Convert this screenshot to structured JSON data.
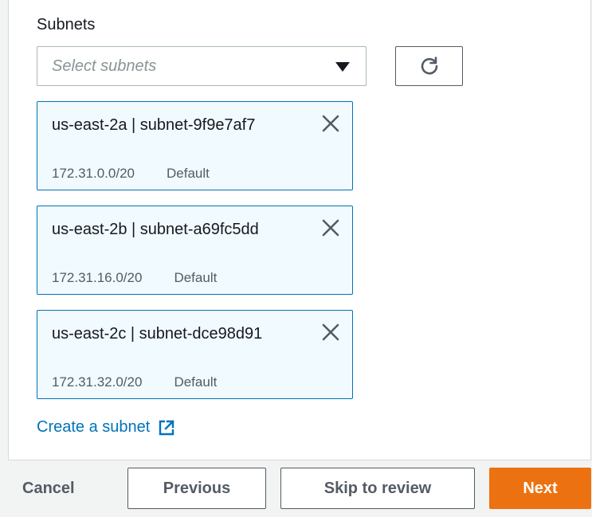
{
  "subnets": {
    "label": "Subnets",
    "placeholder": "Select subnets",
    "refresh_icon": "refresh-icon",
    "selected": [
      {
        "title": "us-east-2a | subnet-9f9e7af7",
        "cidr": "172.31.0.0/20",
        "tag": "Default"
      },
      {
        "title": "us-east-2b | subnet-a69fc5dd",
        "cidr": "172.31.16.0/20",
        "tag": "Default"
      },
      {
        "title": "us-east-2c | subnet-dce98d91",
        "cidr": "172.31.32.0/20",
        "tag": "Default"
      }
    ],
    "create_link": "Create a subnet"
  },
  "footer": {
    "cancel": "Cancel",
    "previous": "Previous",
    "skip": "Skip to review",
    "next": "Next"
  },
  "colors": {
    "accent_orange": "#ec7211",
    "link_blue": "#0073bb",
    "token_bg": "#f1faff",
    "page_bg": "#f2f3f3"
  }
}
